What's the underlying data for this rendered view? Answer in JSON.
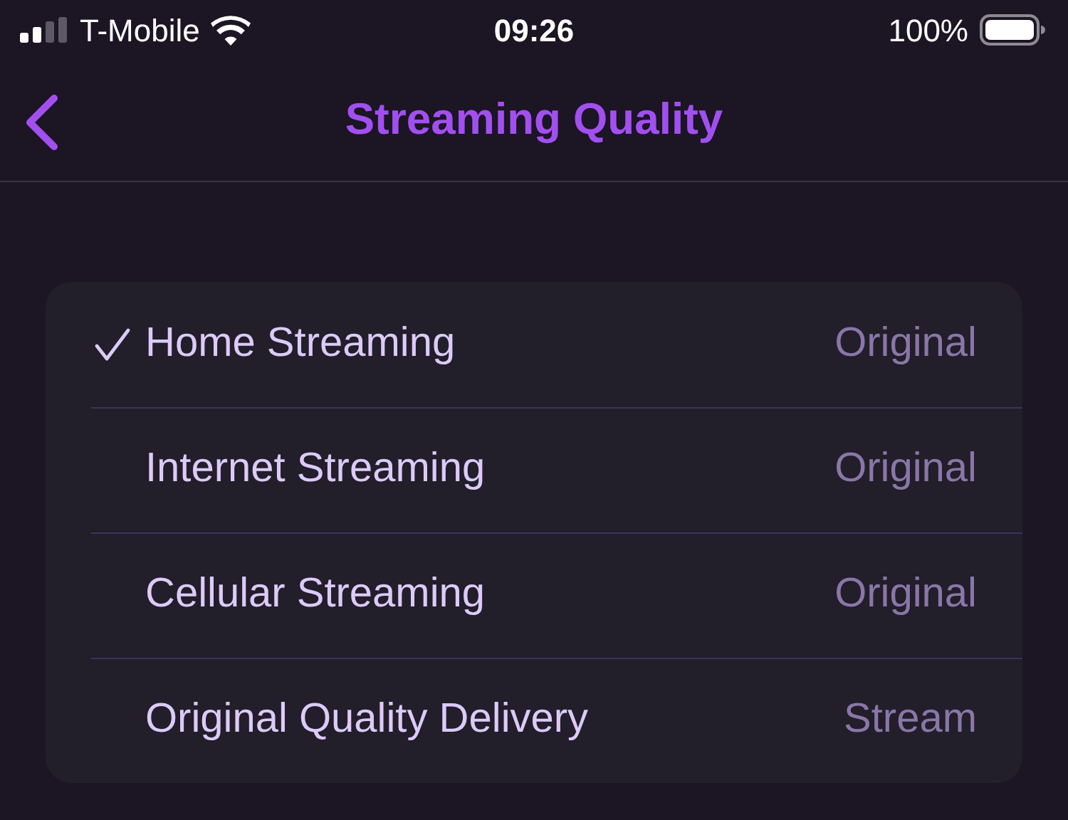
{
  "status_bar": {
    "carrier": "T-Mobile",
    "time": "09:26",
    "battery": "100%"
  },
  "nav": {
    "title": "Streaming Quality"
  },
  "options": [
    {
      "label": "Home Streaming",
      "value": "Original",
      "selected": true
    },
    {
      "label": "Internet Streaming",
      "value": "Original",
      "selected": false
    },
    {
      "label": "Cellular Streaming",
      "value": "Original",
      "selected": false
    },
    {
      "label": "Original Quality Delivery",
      "value": "Stream",
      "selected": false
    }
  ]
}
